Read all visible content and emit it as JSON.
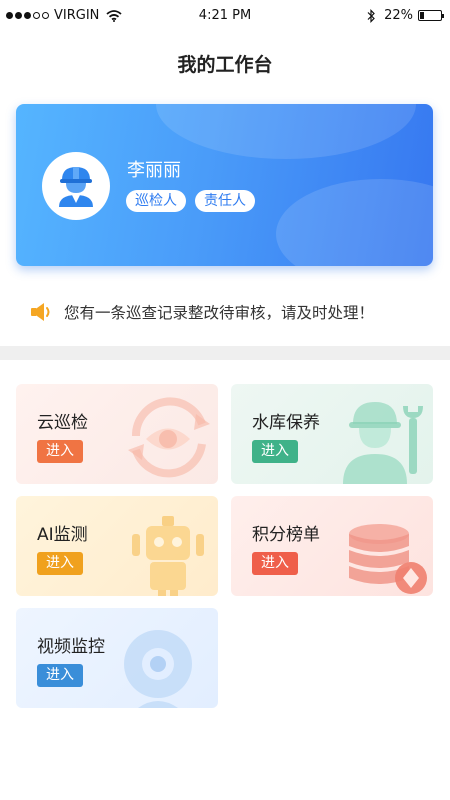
{
  "status_bar": {
    "carrier": "VIRGIN",
    "time": "4:21 PM",
    "battery_percent": "22%",
    "battery_level": 0.22
  },
  "page": {
    "title": "我的工作台"
  },
  "profile": {
    "name": "李丽丽",
    "roles": [
      "巡检人",
      "责任人"
    ],
    "avatar_icon": "worker-helmet-icon"
  },
  "notice": {
    "icon": "speaker-icon",
    "text": "您有一条巡查记录整改待审核，请及时处理！"
  },
  "tiles": [
    {
      "title": "云巡检",
      "button": "进入",
      "icon": "eye-refresh-icon",
      "accent": "#f07443"
    },
    {
      "title": "水库保养",
      "button": "进入",
      "icon": "worker-wrench-icon",
      "accent": "#3fb289"
    },
    {
      "title": "AI监测",
      "button": "进入",
      "icon": "robot-icon",
      "accent": "#f0a11e"
    },
    {
      "title": "积分榜单",
      "button": "进入",
      "icon": "coin-stack-icon",
      "accent": "#ef5f4a"
    },
    {
      "title": "视频监控",
      "button": "进入",
      "icon": "webcam-icon",
      "accent": "#3a8ed9"
    }
  ]
}
